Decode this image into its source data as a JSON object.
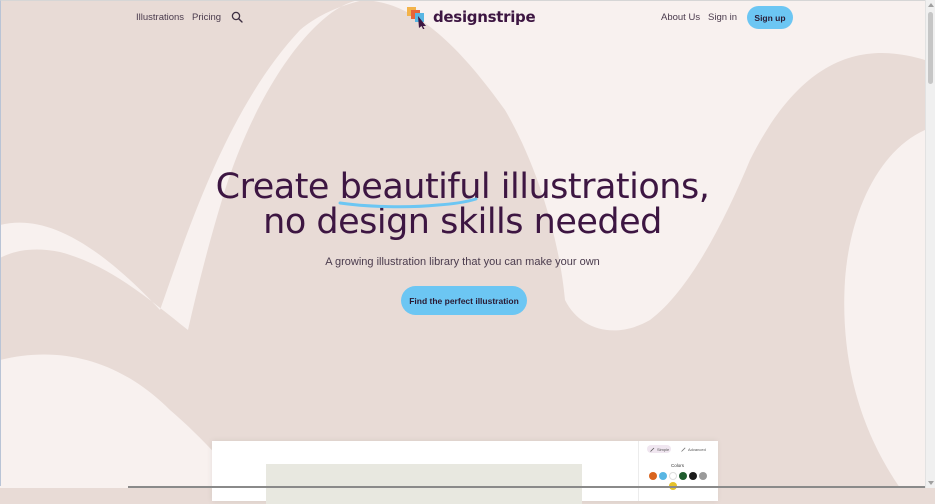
{
  "nav": {
    "illustrations": "Illustrations",
    "pricing": "Pricing",
    "about": "About Us",
    "signin": "Sign in",
    "signup": "Sign up"
  },
  "logo": {
    "text": "designstripe"
  },
  "hero": {
    "headline_pre": "Create ",
    "headline_highlight": "beautiful",
    "headline_post": " illustrations,",
    "headline_line2": "no design skills needed",
    "subtitle": "A growing illustration library that you can make your own",
    "cta": "Find the perfect illustration"
  },
  "editor": {
    "tab_simple": "Simple",
    "tab_advanced": "Advanced",
    "colors_label": "Colors"
  },
  "colors": {
    "background": "#e8dbd6",
    "wave": "#f8f1ef",
    "accent": "#6cc6f3",
    "text_dark": "#3d1642",
    "swatches": [
      "#d9641e",
      "#58b6e3",
      "#ffffff",
      "#1f5c2e",
      "#1c1c1c",
      "#9a9a9a",
      "#e6c229"
    ]
  }
}
